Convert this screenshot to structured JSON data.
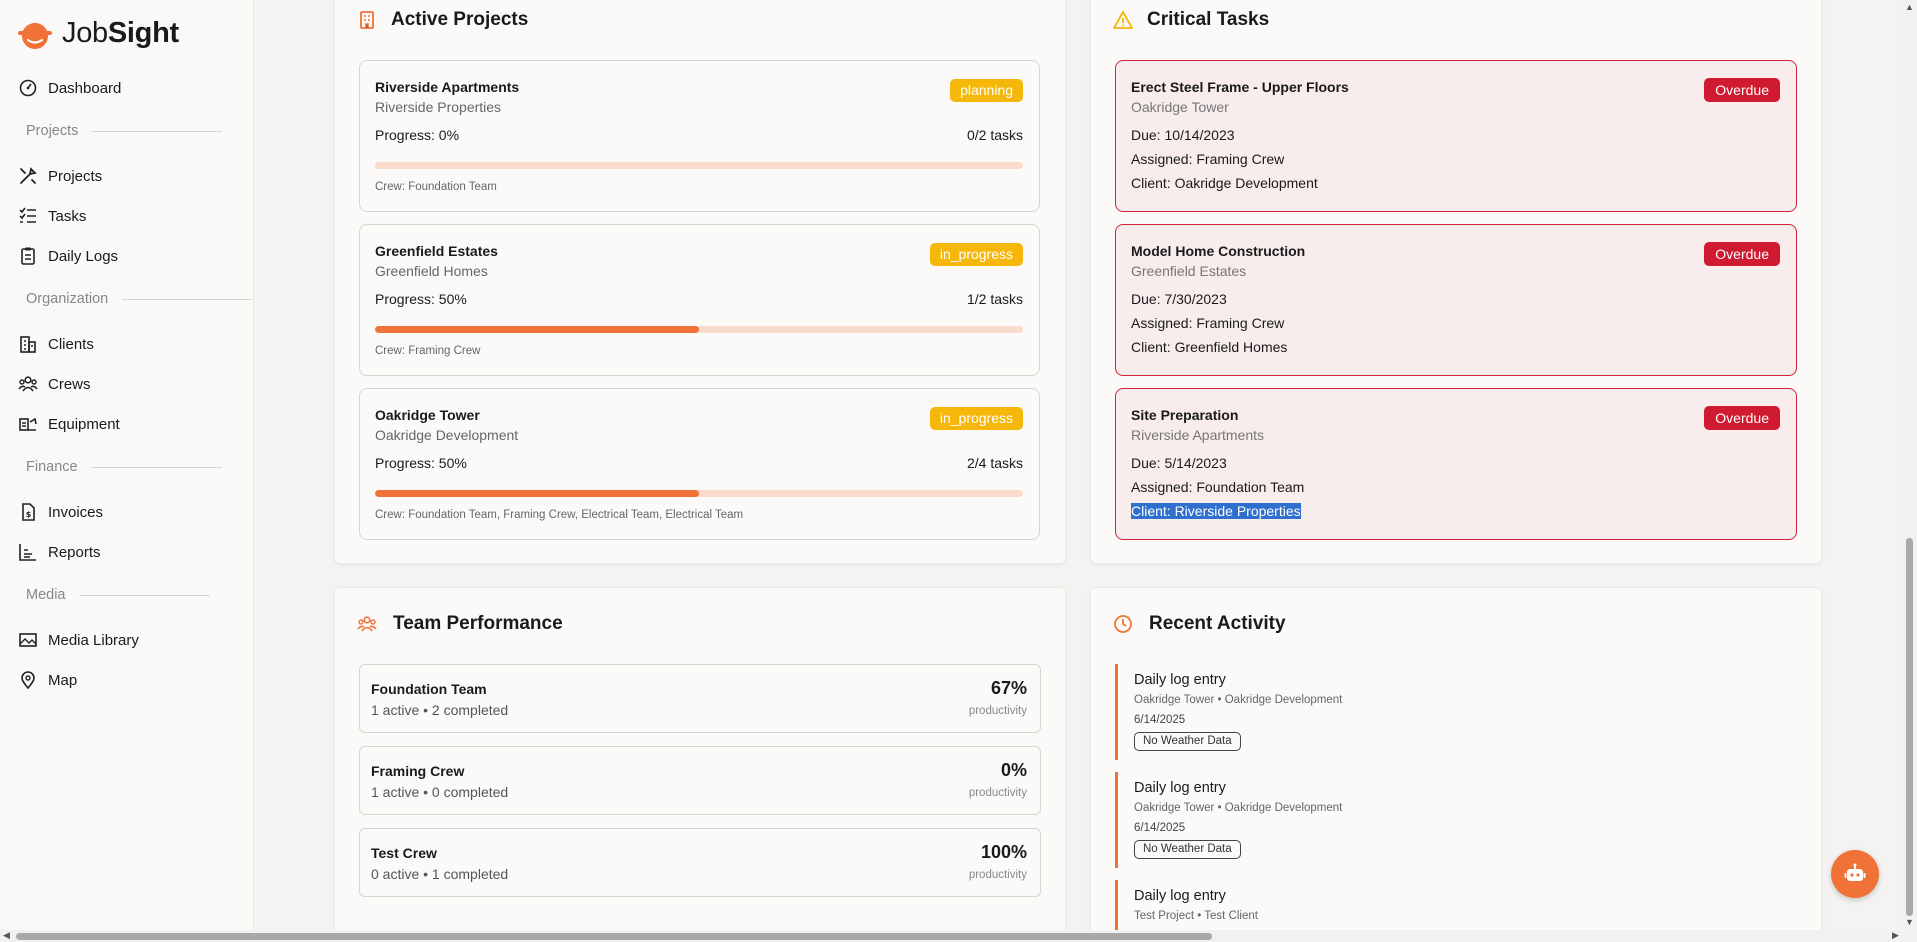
{
  "app": {
    "logo_light": "Job",
    "logo_bold": "Sight"
  },
  "sidebar": {
    "items": [
      {
        "label": "Dashboard",
        "icon": "dashboard-icon"
      },
      {
        "label": "Projects",
        "icon": "tools-icon"
      },
      {
        "label": "Tasks",
        "icon": "checklist-icon"
      },
      {
        "label": "Daily Logs",
        "icon": "clipboard-icon"
      },
      {
        "label": "Clients",
        "icon": "building-icon"
      },
      {
        "label": "Crews",
        "icon": "users-icon"
      },
      {
        "label": "Equipment",
        "icon": "equipment-icon"
      },
      {
        "label": "Invoices",
        "icon": "invoice-icon"
      },
      {
        "label": "Reports",
        "icon": "bar-chart-icon"
      },
      {
        "label": "Media Library",
        "icon": "image-icon"
      },
      {
        "label": "Map",
        "icon": "map-pin-icon"
      }
    ],
    "sections": [
      "Projects",
      "Organization",
      "Finance",
      "Media"
    ]
  },
  "active_projects": {
    "title": "Active Projects",
    "items": [
      {
        "name": "Riverside Apartments",
        "client": "Riverside Properties",
        "status": "planning",
        "progress_label": "Progress: 0%",
        "progress": 0,
        "tasks": "0/2 tasks",
        "crew": "Crew: Foundation Team"
      },
      {
        "name": "Greenfield Estates",
        "client": "Greenfield Homes",
        "status": "in_progress",
        "progress_label": "Progress: 50%",
        "progress": 50,
        "tasks": "1/2 tasks",
        "crew": "Crew: Framing Crew"
      },
      {
        "name": "Oakridge Tower",
        "client": "Oakridge Development",
        "status": "in_progress",
        "progress_label": "Progress: 50%",
        "progress": 50,
        "tasks": "2/4 tasks",
        "crew": "Crew: Foundation Team, Framing Crew, Electrical Team, Electrical Team"
      }
    ]
  },
  "critical_tasks": {
    "title": "Critical Tasks",
    "items": [
      {
        "name": "Erect Steel Frame - Upper Floors",
        "project": "Oakridge Tower",
        "badge": "Overdue",
        "due": "Due: 10/14/2023",
        "assigned": "Assigned: Framing Crew",
        "client": "Client: Oakridge Development"
      },
      {
        "name": "Model Home Construction",
        "project": "Greenfield Estates",
        "badge": "Overdue",
        "due": "Due: 7/30/2023",
        "assigned": "Assigned: Framing Crew",
        "client": "Client: Greenfield Homes"
      },
      {
        "name": "Site Preparation",
        "project": "Riverside Apartments",
        "badge": "Overdue",
        "due": "Due: 5/14/2023",
        "assigned": "Assigned: Foundation Team",
        "client": "Client: Riverside Properties"
      }
    ]
  },
  "team_performance": {
    "title": "Team Performance",
    "items": [
      {
        "name": "Foundation Team",
        "stats": "1 active • 2 completed",
        "pct": "67%",
        "label": "productivity"
      },
      {
        "name": "Framing Crew",
        "stats": "1 active • 0 completed",
        "pct": "0%",
        "label": "productivity"
      },
      {
        "name": "Test Crew",
        "stats": "0 active • 1 completed",
        "pct": "100%",
        "label": "productivity"
      }
    ]
  },
  "recent_activity": {
    "title": "Recent Activity",
    "items": [
      {
        "title": "Daily log entry",
        "sub": "Oakridge Tower • Oakridge Development",
        "date": "6/14/2025",
        "weather": "No Weather Data"
      },
      {
        "title": "Daily log entry",
        "sub": "Oakridge Tower • Oakridge Development",
        "date": "6/14/2025",
        "weather": "No Weather Data"
      },
      {
        "title": "Daily log entry",
        "sub": "Test Project • Test Client",
        "date": "",
        "weather": ""
      }
    ]
  },
  "colors": {
    "accent": "#f07236",
    "danger": "#cf1a30",
    "warning": "#f5b70a"
  }
}
